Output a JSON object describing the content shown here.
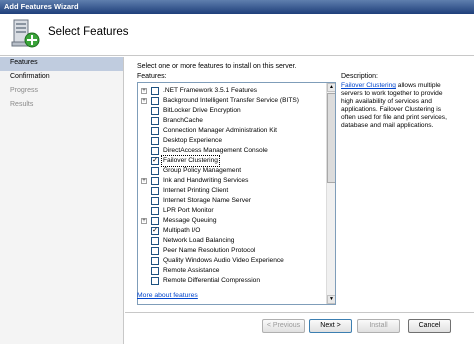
{
  "window": {
    "title": "Add Features Wizard"
  },
  "header": {
    "title": "Select Features",
    "icon": "server-add-icon"
  },
  "nav": {
    "items": [
      {
        "label": "Features",
        "state": "active"
      },
      {
        "label": "Confirmation",
        "state": "enabled"
      },
      {
        "label": "Progress",
        "state": "disabled"
      },
      {
        "label": "Results",
        "state": "disabled"
      }
    ]
  },
  "main": {
    "instruction": "Select one or more features to install on this server.",
    "features_label": "Features:",
    "features": [
      {
        "label": ".NET Framework 3.5.1 Features",
        "expandable": true,
        "checked": false
      },
      {
        "label": "Background Intelligent Transfer Service (BITS)",
        "expandable": true,
        "checked": false
      },
      {
        "label": "BitLocker Drive Encryption",
        "expandable": false,
        "checked": false
      },
      {
        "label": "BranchCache",
        "expandable": false,
        "checked": false
      },
      {
        "label": "Connection Manager Administration Kit",
        "expandable": false,
        "checked": false
      },
      {
        "label": "Desktop Experience",
        "expandable": false,
        "checked": false
      },
      {
        "label": "DirectAccess Management Console",
        "expandable": false,
        "checked": false
      },
      {
        "label": "Failover Clustering",
        "expandable": false,
        "checked": true,
        "selected": true
      },
      {
        "label": "Group Policy Management",
        "expandable": false,
        "checked": false
      },
      {
        "label": "Ink and Handwriting Services",
        "expandable": true,
        "checked": false
      },
      {
        "label": "Internet Printing Client",
        "expandable": false,
        "checked": false
      },
      {
        "label": "Internet Storage Name Server",
        "expandable": false,
        "checked": false
      },
      {
        "label": "LPR Port Monitor",
        "expandable": false,
        "checked": false
      },
      {
        "label": "Message Queuing",
        "expandable": true,
        "checked": false
      },
      {
        "label": "Multipath I/O",
        "expandable": false,
        "checked": true
      },
      {
        "label": "Network Load Balancing",
        "expandable": false,
        "checked": false
      },
      {
        "label": "Peer Name Resolution Protocol",
        "expandable": false,
        "checked": false
      },
      {
        "label": "Quality Windows Audio Video Experience",
        "expandable": false,
        "checked": false
      },
      {
        "label": "Remote Assistance",
        "expandable": false,
        "checked": false
      },
      {
        "label": "Remote Differential Compression",
        "expandable": false,
        "checked": false
      }
    ],
    "description_label": "Description:",
    "description_link": "Failover Clustering",
    "description_text": " allows multiple servers to work together to provide high availability of services and applications. Failover Clustering is often used for file and print services, database and mail applications.",
    "more_link": "More about features"
  },
  "buttons": {
    "previous": "< Previous",
    "next": "Next >",
    "install": "Install",
    "cancel": "Cancel"
  },
  "colors": {
    "title_bar": "#1f3f7a",
    "nav_active": "#c0ccdf",
    "link": "#0044cc"
  }
}
